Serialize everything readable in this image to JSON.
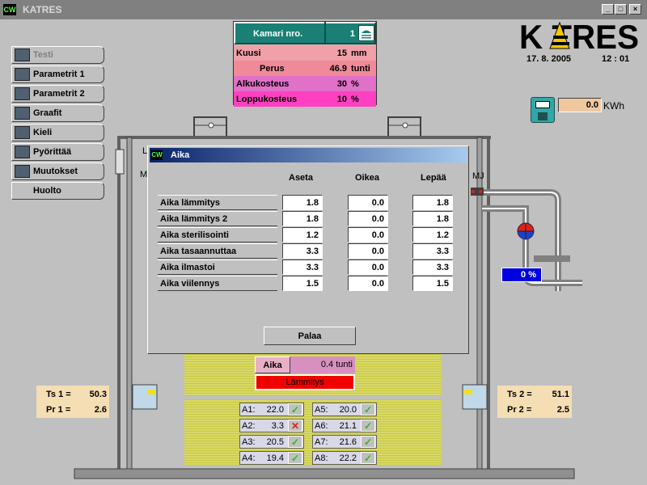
{
  "window": {
    "title": "KATRES",
    "icon": "CW"
  },
  "nav": [
    {
      "label": "Testi",
      "icon": "test-icon",
      "disabled": true
    },
    {
      "label": "Parametrit 1",
      "icon": "params-icon"
    },
    {
      "label": "Parametrit 2",
      "icon": "params-icon"
    },
    {
      "label": "Graafit",
      "icon": "graph-icon"
    },
    {
      "label": "Kieli",
      "icon": "language-icon"
    },
    {
      "label": "Pyörittää",
      "icon": "rotate-icon"
    },
    {
      "label": "Muutokset",
      "icon": "changes-icon"
    },
    {
      "label": "Huolto",
      "icon": ""
    }
  ],
  "kamari": {
    "label": "Kamari nro.",
    "value": "1",
    "rows": [
      {
        "label": "Kuusi",
        "value": "15",
        "unit": "mm",
        "color": "#f0a0a8"
      },
      {
        "label": "Perus",
        "value": "46.9",
        "unit": "tunti",
        "color": "#f08a98"
      },
      {
        "label": "Alkukosteus",
        "value": "30",
        "unit": "%",
        "color": "#e070c8"
      },
      {
        "label": "Loppukosteus",
        "value": "10",
        "unit": "%",
        "color": "#ff40c0"
      }
    ]
  },
  "logo": {
    "text": "KATRES"
  },
  "date": "17. 8. 2005",
  "time": "12 : 01",
  "energy": {
    "value": "0.0",
    "unit": "KWh"
  },
  "pipe_label": "MJ",
  "valve": {
    "value": "0 %"
  },
  "dialog": {
    "title": "Aika",
    "icon": "CW",
    "columns": [
      "Aseta",
      "Oikea",
      "Lepää"
    ],
    "rows": [
      {
        "label": "Aika lämmitys",
        "values": [
          "1.8",
          "0.0",
          "1.8"
        ]
      },
      {
        "label": "Aika lämmitys 2",
        "values": [
          "1.8",
          "0.0",
          "1.8"
        ]
      },
      {
        "label": "Aika sterilisointi",
        "values": [
          "1.2",
          "0.0",
          "1.2"
        ]
      },
      {
        "label": "Aika tasaannuttaa",
        "values": [
          "3.3",
          "0.0",
          "3.3"
        ]
      },
      {
        "label": "Aika ilmastoi",
        "values": [
          "3.3",
          "0.0",
          "3.3"
        ]
      },
      {
        "label": "Aika viilennys",
        "values": [
          "1.5",
          "0.0",
          "1.5"
        ]
      }
    ],
    "back_label": "Palaa"
  },
  "status": {
    "aika_label": "Aika",
    "aika_value": "0.4 tunti",
    "phase": "Lämmitys"
  },
  "left_sensors": {
    "ts_label": "Ts 1 =",
    "ts_value": "50.3",
    "pr_label": "Pr 1 =",
    "pr_value": "2.6"
  },
  "right_sensors": {
    "ts_label": "Ts 2 =",
    "ts_value": "51.1",
    "pr_label": "Pr 2 =",
    "pr_value": "2.5"
  },
  "sensors": [
    {
      "label": "A1:",
      "value": "22.0",
      "ok": true
    },
    {
      "label": "A2:",
      "value": "3.3",
      "ok": false
    },
    {
      "label": "A3:",
      "value": "20.5",
      "ok": true
    },
    {
      "label": "A4:",
      "value": "19.4",
      "ok": true
    },
    {
      "label": "A5:",
      "value": "20.0",
      "ok": true
    },
    {
      "label": "A6:",
      "value": "21.1",
      "ok": true
    },
    {
      "label": "A7:",
      "value": "21.6",
      "ok": true
    },
    {
      "label": "A8:",
      "value": "22.2",
      "ok": true
    }
  ]
}
